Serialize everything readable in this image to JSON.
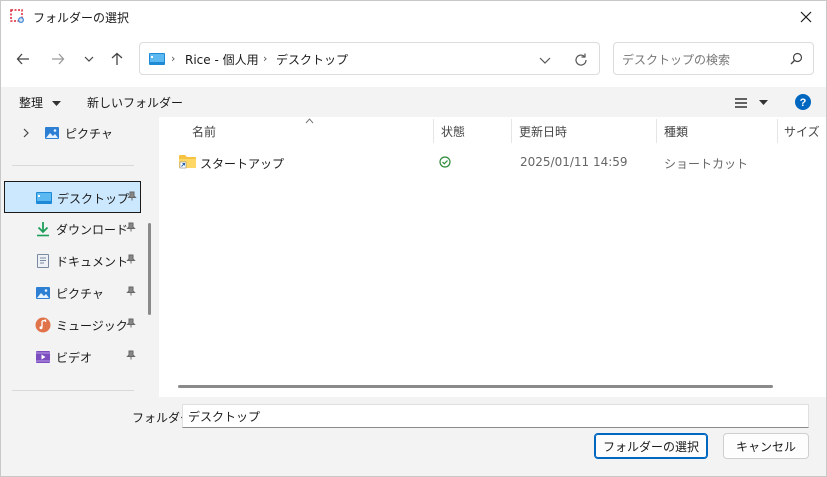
{
  "window": {
    "title": "フォルダーの選択"
  },
  "address": {
    "crumbs": [
      "Rice - 個人用",
      "デスクトップ"
    ],
    "separator": "›"
  },
  "search": {
    "placeholder": "デスクトップの検索"
  },
  "toolbar": {
    "organize": "整理",
    "new_folder": "新しいフォルダー"
  },
  "nav": {
    "items": [
      {
        "label": "ピクチャ",
        "icon": "pictures-icon"
      },
      {
        "label": "デスクトップ",
        "icon": "desktop-icon",
        "pinned": true,
        "selected": true
      },
      {
        "label": "ダウンロード",
        "icon": "download-icon",
        "pinned": true
      },
      {
        "label": "ドキュメント",
        "icon": "documents-icon",
        "pinned": true
      },
      {
        "label": "ピクチャ",
        "icon": "pictures-icon",
        "pinned": true
      },
      {
        "label": "ミュージック",
        "icon": "music-icon",
        "pinned": true
      },
      {
        "label": "ビデオ",
        "icon": "videos-icon",
        "pinned": true
      }
    ]
  },
  "filelist": {
    "columns": [
      "名前",
      "状態",
      "更新日時",
      "種類",
      "サイズ"
    ],
    "rows": [
      {
        "name": "スタートアップ",
        "status": "synced",
        "modified": "2025/01/11 14:59",
        "type": "ショートカット",
        "size": ""
      }
    ]
  },
  "bottom": {
    "folder_label": "フォルダー:",
    "folder_value": "デスクトップ",
    "select_button": "フォルダーの選択",
    "cancel_button": "キャンセル"
  },
  "colors": {
    "accent": "#0067c0",
    "selection": "#cce8ff",
    "help": "#0067c0",
    "synced": "#2e8b3a"
  }
}
